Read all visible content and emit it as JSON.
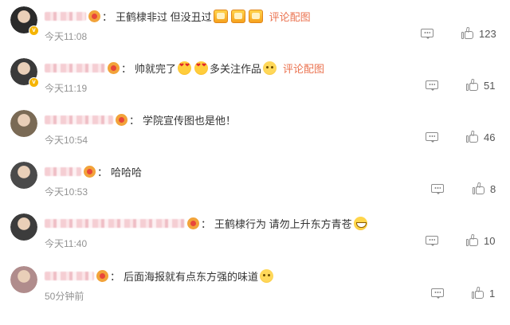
{
  "comments": [
    {
      "segments": [
        {
          "t": "王鹤棣非过 但没丑过",
          "k": "text"
        }
      ],
      "emojis_after": [
        "rect",
        "rect",
        "rect"
      ],
      "link": "评论配图",
      "time": "今天11:08",
      "likes": "123",
      "verified": true,
      "avatar_color": "#2b2b2b",
      "name_blur_width": 52
    },
    {
      "segments": [
        {
          "t": "帅就完了",
          "k": "text"
        }
      ],
      "mid": [
        "heart",
        "heart"
      ],
      "segments2": "多关注作品",
      "emojis_after": [
        "think"
      ],
      "link": "评论配图",
      "time": "今天11:19",
      "likes": "51",
      "verified": true,
      "avatar_color": "#3a3a3a",
      "name_blur_width": 76
    },
    {
      "segments": [
        {
          "t": "学院宣传图也是他！",
          "k": "text"
        }
      ],
      "emojis_after": [],
      "link": "",
      "time": "今天10:54",
      "likes": "46",
      "verified": false,
      "avatar_color": "#7a6a55",
      "name_blur_width": 86
    },
    {
      "segments": [
        {
          "t": "哈哈哈",
          "k": "text"
        }
      ],
      "emojis_after": [],
      "link": "",
      "time": "今天10:53",
      "likes": "8",
      "verified": false,
      "avatar_color": "#4a4a4a",
      "name_blur_width": 46
    },
    {
      "segments": [
        {
          "t": "王鹤棣行为 请勿上升东方青苍",
          "k": "text"
        }
      ],
      "emojis_after": [
        "grin"
      ],
      "link": "",
      "time": "今天11:40",
      "likes": "10",
      "verified": false,
      "avatar_color": "#3c3c3c",
      "name_blur_width": 176
    },
    {
      "segments": [
        {
          "t": "后面海报就有点东方强的味道",
          "k": "text"
        }
      ],
      "emojis_after": [
        "think"
      ],
      "link": "",
      "time": "50分钟前",
      "likes": "1",
      "verified": false,
      "avatar_color": "#b08c8c",
      "name_blur_width": 62
    }
  ],
  "colors": {
    "link": "#eb7350",
    "time": "#939393",
    "icon": "#8c8c8c"
  },
  "icons": {
    "reply": "comment-icon",
    "like": "thumbs-up-icon",
    "level": "user-level-badge-icon",
    "verified": "verified-badge-icon"
  }
}
